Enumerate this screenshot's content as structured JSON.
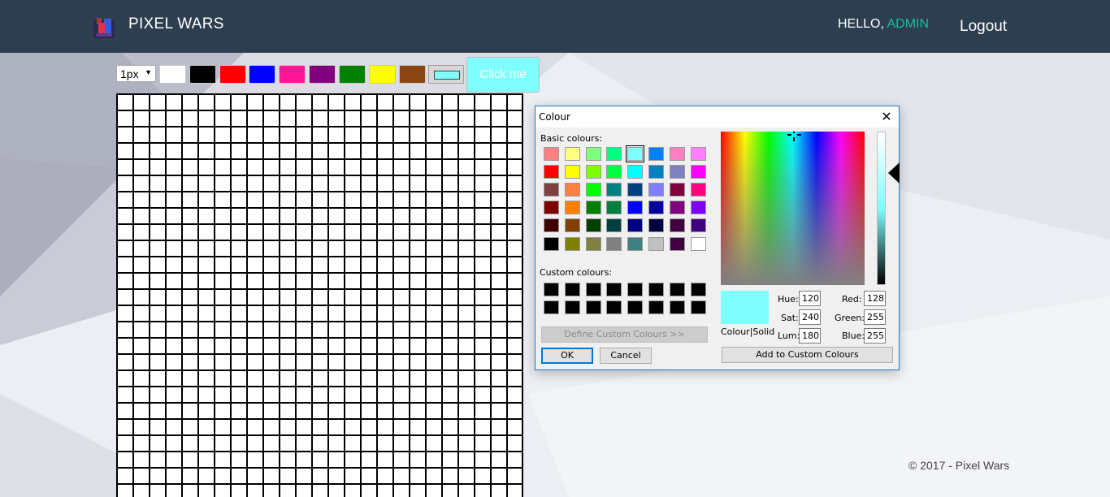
{
  "navbar": {
    "brand": "PIXEL WARS",
    "greeting_prefix": "HELLO,",
    "username": "ADMIN",
    "logout_label": "Logout"
  },
  "toolbar": {
    "brush_size": "1px",
    "palette": [
      {
        "name": "white",
        "color": "#ffffff"
      },
      {
        "name": "black",
        "color": "#000000"
      },
      {
        "name": "red",
        "color": "#ff0000"
      },
      {
        "name": "blue",
        "color": "#0000ff"
      },
      {
        "name": "pink",
        "color": "#ff1493"
      },
      {
        "name": "purple",
        "color": "#800080"
      },
      {
        "name": "green",
        "color": "#008000"
      },
      {
        "name": "yellow",
        "color": "#ffff00"
      },
      {
        "name": "brown",
        "color": "#8b4513"
      }
    ],
    "current_color": "#80ffff",
    "click_label": "Click me"
  },
  "footer": {
    "text": "© 2017 - Pixel Wars"
  },
  "colour_dialog": {
    "title": "Colour",
    "basic_label": "Basic colours:",
    "custom_label": "Custom colours:",
    "basic_colours": [
      [
        "#ff8080",
        "#ffff80",
        "#80ff80",
        "#00ff80",
        "#80ffff",
        "#0080ff",
        "#ff80c0",
        "#ff80ff"
      ],
      [
        "#ff0000",
        "#ffff00",
        "#80ff00",
        "#00ff40",
        "#00ffff",
        "#0080c0",
        "#8080c0",
        "#ff00ff"
      ],
      [
        "#804040",
        "#ff8040",
        "#00ff00",
        "#008080",
        "#004080",
        "#8080ff",
        "#800040",
        "#ff0080"
      ],
      [
        "#800000",
        "#ff8000",
        "#008000",
        "#008040",
        "#0000ff",
        "#0000a0",
        "#800080",
        "#8000ff"
      ],
      [
        "#400000",
        "#804000",
        "#004000",
        "#004040",
        "#000080",
        "#000040",
        "#400040",
        "#400080"
      ],
      [
        "#000000",
        "#808000",
        "#808040",
        "#808080",
        "#408080",
        "#c0c0c0",
        "#400040",
        "#ffffff"
      ]
    ],
    "selected_basic": "#80ffff",
    "custom_colour_count": 16,
    "define_custom_label": "Define Custom Colours >>",
    "ok_label": "OK",
    "cancel_label": "Cancel",
    "add_custom_label": "Add to Custom Colours",
    "preview_label": "Colour|Solid",
    "preview_color": "#80ffff",
    "hue_label": "Hue:",
    "hue": "120",
    "sat_label": "Sat:",
    "sat": "240",
    "lum_label": "Lum:",
    "lum": "180",
    "red_label": "Red:",
    "red": "128",
    "green_label": "Green:",
    "green": "255",
    "blue_label": "Blue:",
    "blue": "255"
  }
}
